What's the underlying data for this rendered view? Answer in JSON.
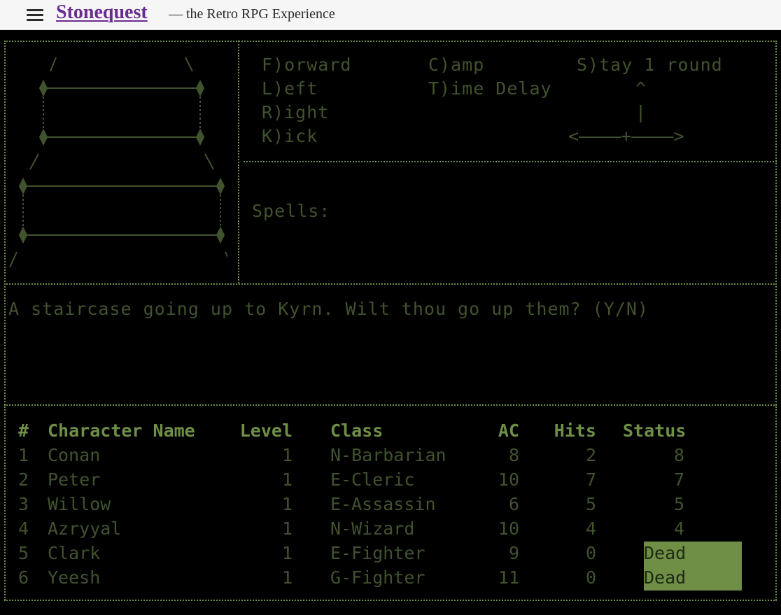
{
  "header": {
    "menu_icon": "hamburger-menu-icon",
    "title": "Stonequest",
    "tagline": "— the Retro RPG Experience"
  },
  "colors": {
    "background": "#000000",
    "phosphor_dim": "#41522e",
    "phosphor_bright": "#6f8f47",
    "dead_highlight": "#6f8f47",
    "title_link": "#6b2c91"
  },
  "commands": {
    "forward": "F)orward",
    "left": "L)eft",
    "right": "R)ight",
    "kick": "K)ick",
    "camp": "C)amp",
    "time_delay": "T)ime Delay",
    "stay": "S)tay 1 round"
  },
  "compass": {
    "up": "^",
    "stem": "|",
    "horizontal": "<————+————>"
  },
  "spells": {
    "label": "Spells:"
  },
  "message": "A staircase going up to Kyrn. Wilt thou go up them? (Y/N)",
  "party": {
    "headers": {
      "num": "#",
      "name": "Character Name",
      "level": "Level",
      "class": "Class",
      "ac": "AC",
      "hits": "Hits",
      "status": "Status"
    },
    "rows": [
      {
        "num": "1",
        "name": "Conan",
        "level": "1",
        "class": "N-Barbarian",
        "ac": "8",
        "hits": "2",
        "status": "8"
      },
      {
        "num": "2",
        "name": "Peter",
        "level": "1",
        "class": "E-Cleric",
        "ac": "10",
        "hits": "7",
        "status": "7"
      },
      {
        "num": "3",
        "name": "Willow",
        "level": "1",
        "class": "E-Assassin",
        "ac": "6",
        "hits": "5",
        "status": "5"
      },
      {
        "num": "4",
        "name": "Azryyal",
        "level": "1",
        "class": "N-Wizard",
        "ac": "10",
        "hits": "4",
        "status": "4"
      },
      {
        "num": "5",
        "name": "Clark",
        "level": "1",
        "class": "E-Fighter",
        "ac": "9",
        "hits": "0",
        "status": "Dead"
      },
      {
        "num": "6",
        "name": "Yeesh",
        "level": "1",
        "class": "G-Fighter",
        "ac": "11",
        "hits": "0",
        "status": "Dead"
      }
    ]
  }
}
